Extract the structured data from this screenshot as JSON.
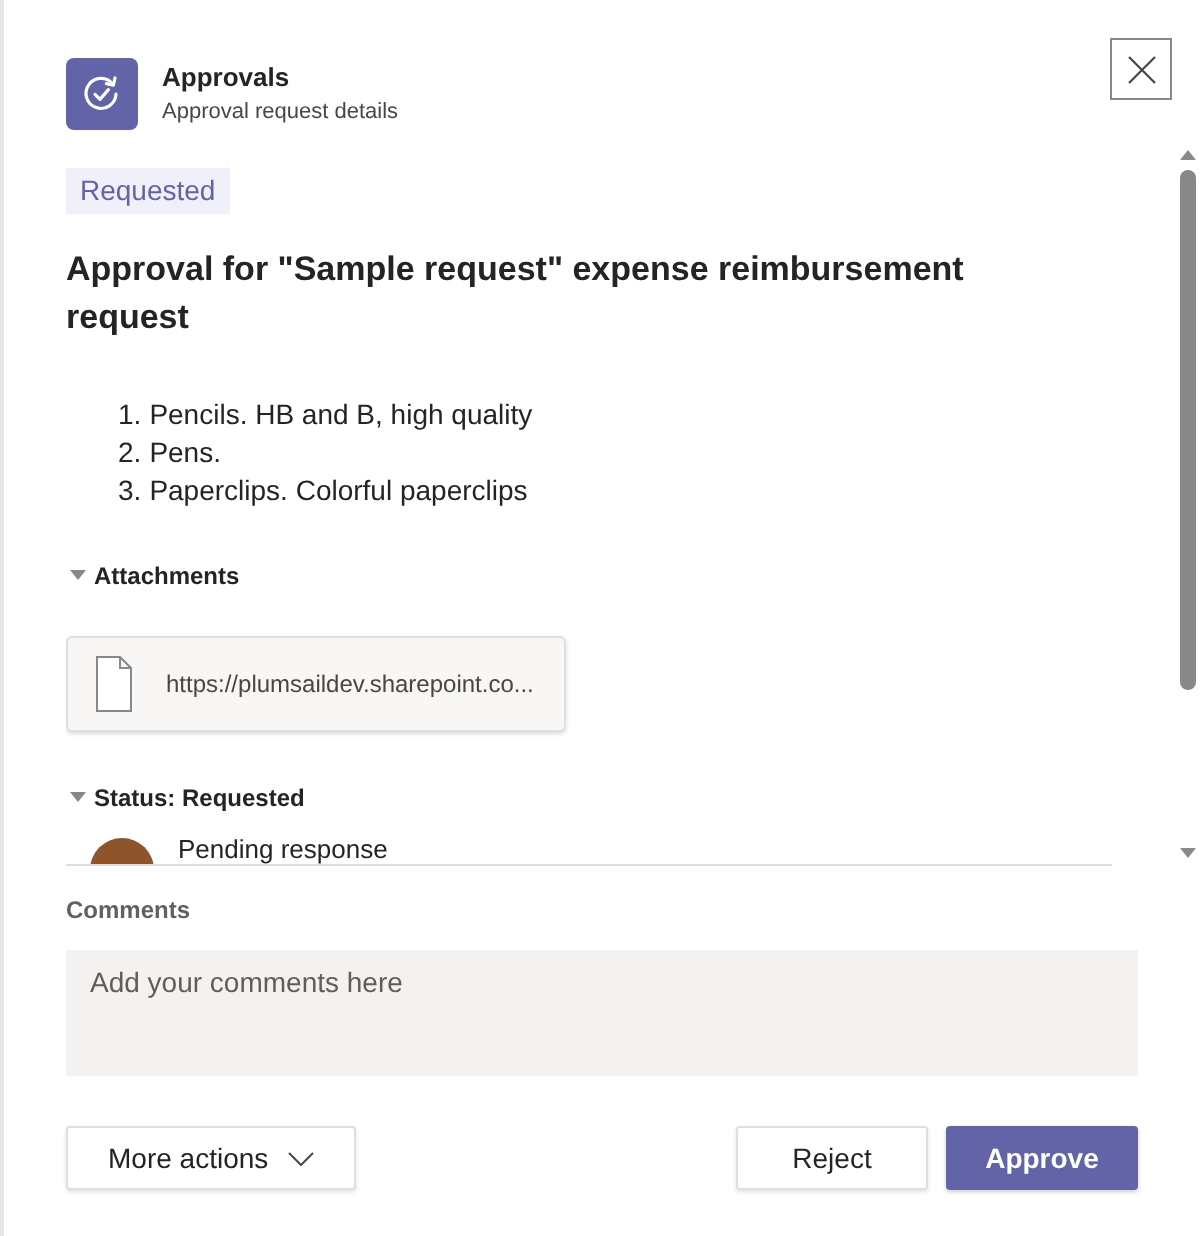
{
  "app": {
    "name": "Approvals",
    "subtitle": "Approval request details"
  },
  "status_badge": "Requested",
  "title": "Approval for \"Sample request\" expense reimbursement request",
  "items": [
    {
      "number": "1.",
      "text": "Pencils. HB and B, high quality"
    },
    {
      "number": "2.",
      "text": "Pens."
    },
    {
      "number": "3.",
      "text": "Paperclips. Colorful paperclips"
    }
  ],
  "sections": [
    {
      "kind": "attachments",
      "label": "Attachments",
      "expanded": true,
      "attachments": [
        {
          "url": "https://plumsaildev.sharepoint.co..."
        }
      ]
    },
    {
      "kind": "status",
      "label": "Status: Requested",
      "expanded": true,
      "responses": [
        {
          "text": "Pending response"
        }
      ]
    }
  ],
  "comments": {
    "label": "Comments",
    "placeholder": "Add your comments here"
  },
  "actions": [
    {
      "kind": "menu",
      "label": "More actions"
    },
    {
      "kind": "secondary",
      "label": "Reject"
    },
    {
      "kind": "primary",
      "label": "Approve"
    }
  ]
}
